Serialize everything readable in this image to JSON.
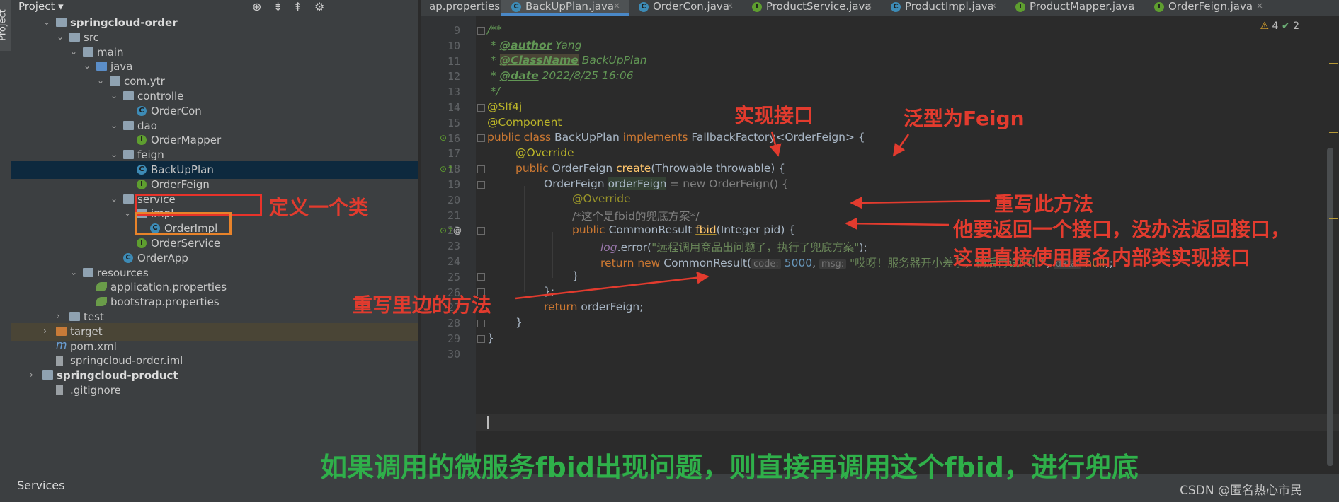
{
  "sidebar": {
    "vertical_tab": "Project"
  },
  "project": {
    "title": "Project",
    "title_caret": "▾",
    "toolbar_icons": [
      "crosshair-icon",
      "expand-all-icon",
      "collapse-all-icon",
      "settings-icon"
    ],
    "tree": [
      {
        "label": "springcloud-order",
        "depth": 1,
        "arrow": "expanded",
        "icon": "module",
        "bold": true
      },
      {
        "label": "src",
        "depth": 2,
        "arrow": "expanded",
        "icon": "folder"
      },
      {
        "label": "main",
        "depth": 3,
        "arrow": "expanded",
        "icon": "folder"
      },
      {
        "label": "java",
        "depth": 4,
        "arrow": "expanded",
        "icon": "folder-blue"
      },
      {
        "label": "com.ytr",
        "depth": 5,
        "arrow": "expanded",
        "icon": "package"
      },
      {
        "label": "controlle",
        "depth": 6,
        "arrow": "expanded",
        "icon": "package"
      },
      {
        "label": "OrderCon",
        "depth": 7,
        "arrow": "",
        "icon": "class"
      },
      {
        "label": "dao",
        "depth": 6,
        "arrow": "expanded",
        "icon": "package"
      },
      {
        "label": "OrderMapper",
        "depth": 7,
        "arrow": "",
        "icon": "interface"
      },
      {
        "label": "feign",
        "depth": 6,
        "arrow": "expanded",
        "icon": "package"
      },
      {
        "label": "BackUpPlan",
        "depth": 7,
        "arrow": "",
        "icon": "class",
        "selected": true
      },
      {
        "label": "OrderFeign",
        "depth": 7,
        "arrow": "",
        "icon": "interface"
      },
      {
        "label": "service",
        "depth": 6,
        "arrow": "expanded",
        "icon": "package"
      },
      {
        "label": "impl",
        "depth": 7,
        "arrow": "expanded",
        "icon": "package"
      },
      {
        "label": "OrderImpl",
        "depth": 8,
        "arrow": "",
        "icon": "class"
      },
      {
        "label": "OrderService",
        "depth": 7,
        "arrow": "",
        "icon": "interface"
      },
      {
        "label": "OrderApp",
        "depth": 6,
        "arrow": "",
        "icon": "app"
      },
      {
        "label": "resources",
        "depth": 3,
        "arrow": "expanded",
        "icon": "folder-res"
      },
      {
        "label": "application.properties",
        "depth": 4,
        "arrow": "",
        "icon": "leaf"
      },
      {
        "label": "bootstrap.properties",
        "depth": 4,
        "arrow": "",
        "icon": "leaf"
      },
      {
        "label": "test",
        "depth": 2,
        "arrow": "collapsed",
        "icon": "folder"
      },
      {
        "label": "target",
        "depth": 1,
        "arrow": "collapsed",
        "icon": "folder-orange",
        "highlight": true
      },
      {
        "label": "pom.xml",
        "depth": 1,
        "arrow": "",
        "icon": "maven"
      },
      {
        "label": "springcloud-order.iml",
        "depth": 1,
        "arrow": "",
        "icon": "file"
      },
      {
        "label": "springcloud-product",
        "depth": 0,
        "arrow": "collapsed",
        "icon": "module",
        "bold": true
      },
      {
        "label": ".gitignore",
        "depth": 1,
        "arrow": "",
        "icon": "file"
      }
    ]
  },
  "tabs": [
    {
      "label": "ap.properties",
      "icon": "leaf",
      "close": false
    },
    {
      "label": "BackUpPlan.java",
      "icon": "C",
      "active": true,
      "close": true
    },
    {
      "label": "OrderCon.java",
      "icon": "C",
      "close": true
    },
    {
      "label": "ProductService.java",
      "icon": "I",
      "close": true
    },
    {
      "label": "ProductImpl.java",
      "icon": "C",
      "close": true
    },
    {
      "label": "ProductMapper.java",
      "icon": "I",
      "close": true
    },
    {
      "label": "OrderFeign.java",
      "icon": "I",
      "close": true
    }
  ],
  "tab_close_glyph": "×",
  "inspections": {
    "warnings": "4",
    "checks": "2",
    "warn_glyph": "⚠",
    "check_glyph": "✔"
  },
  "editor": {
    "line_numbers": [
      "9",
      "10",
      "11",
      "12",
      "13",
      "14",
      "15",
      "16",
      "17",
      "18",
      "19",
      "20",
      "21",
      "22",
      "23",
      "24",
      "25",
      "26",
      "27",
      "28",
      "29",
      "30"
    ],
    "l9": "/**",
    "l10_star": " * ",
    "l10_tag": "@author",
    "l10_val": " Yang",
    "l11_star": " * ",
    "l11_tag": "@ClassName",
    "l11_val": " BackUpPlan",
    "l12_star": " * ",
    "l12_tag": "@date",
    "l12_val": " 2022/8/25 16:06",
    "l13": " */",
    "l14": "@Slf4j",
    "l15": "@Component",
    "l16_a": "public class",
    "l16_b": " BackUpPlan ",
    "l16_c": "implements",
    "l16_d": " FallbackFactory<OrderFeign> {",
    "l17": "@Override",
    "l18_a": "public",
    "l18_b": " OrderFeign ",
    "l18_c": "create",
    "l18_d": "(Throwable throwable) {",
    "l19_a": "OrderFeign ",
    "l19_b": "orderFeign",
    "l19_c": " = new OrderFeign() {",
    "l20": "@Override",
    "l21_a": "/*这个是",
    "l21_b": "fbid",
    "l21_c": "的兜底方案*/",
    "l22_a": "public",
    "l22_b": " CommonResult ",
    "l22_c": "fbid",
    "l22_d": "(Integer pid) {",
    "l23_a": "log",
    "l23_b": ".error(",
    "l23_c": "\"远程调用商品出问题了，执行了兜底方案\"",
    "l23_d": ");",
    "l24_a": "return new",
    "l24_b": " CommonResult(",
    "l24_h1": "code:",
    "l24_n": "5000",
    "l24_s1": ", ",
    "l24_h2": "msg:",
    "l24_str": "\"哎呀！服务器开小差了，稍后再试吧！\"",
    "l24_s2": ", ",
    "l24_h3": "data:",
    "l24_kw": "null",
    "l24_end": ");",
    "l25": "}",
    "l26": "};",
    "l27_a": "return",
    "l27_b": " orderFeign;",
    "l28": "}",
    "l29": "}",
    "gutter_glyphs": {
      "g16": "⊙",
      "g18": "⊙↑",
      "g22": "⊙↑",
      "g22_at": "@"
    }
  },
  "annotations": {
    "define_class": "定义一个类",
    "implement_interface": "实现接口",
    "generic_feign": "泛型为Feign",
    "override_this": "重写此方法",
    "return_interface_1": "他要返回一个接口，没办法返回接口，",
    "return_interface_2": "这里直接使用匿名内部类实现接口",
    "override_inner": "重写里边的方法",
    "bottom_note": "如果调用的微服务fbid出现问题，则直接再调用这个fbid，进行兜底"
  },
  "bottom_bar": {
    "services": "Services",
    "watermark": "CSDN @匿名热心市民"
  },
  "colors": {
    "annotation_red": "#e23b2e",
    "annotation_green": "#2fb04a",
    "box_red": "#e8332a",
    "box_orange": "#e8832a"
  }
}
